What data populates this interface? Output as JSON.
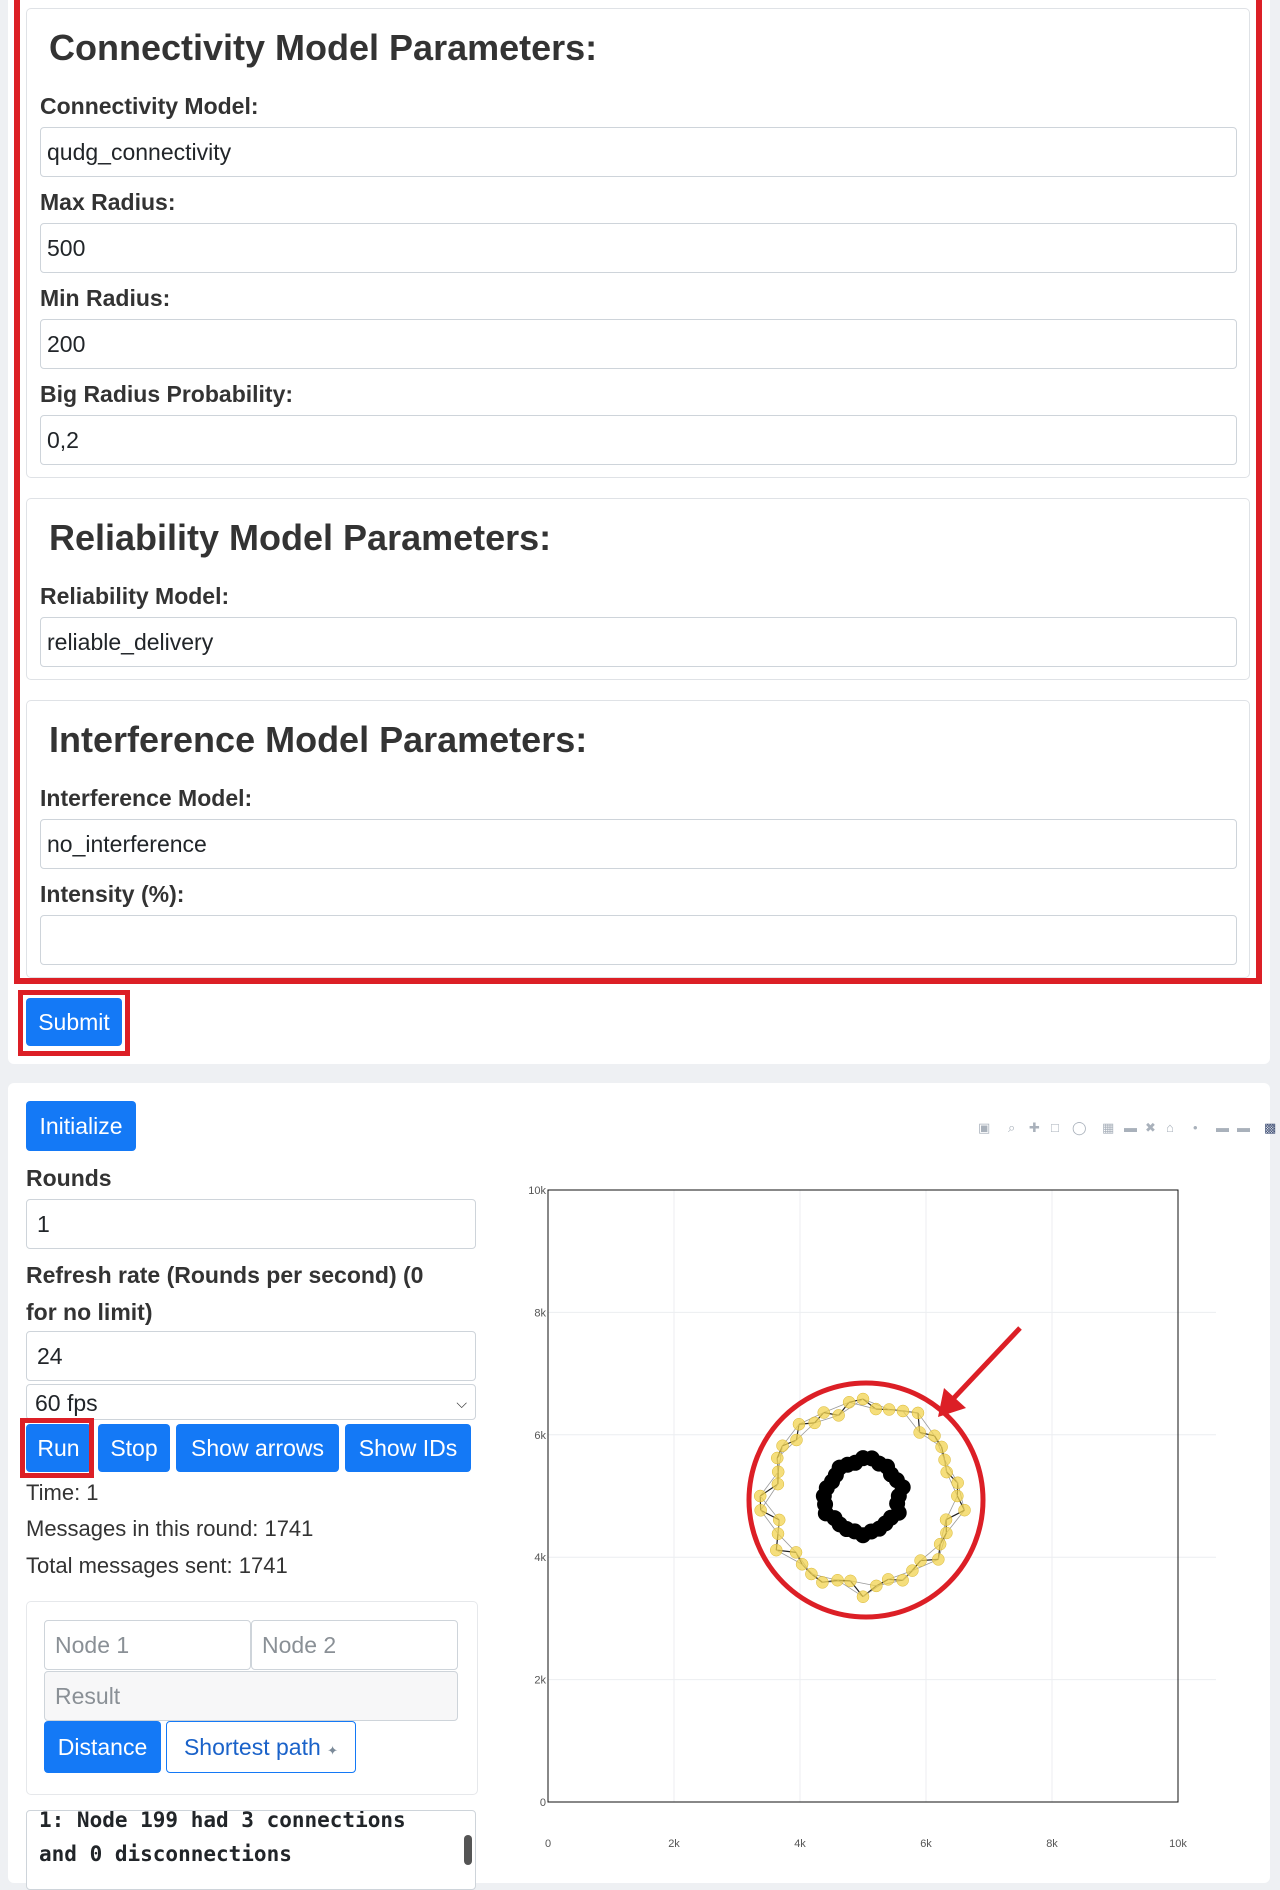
{
  "connectivity": {
    "title": "Connectivity Model Parameters:",
    "fields": [
      {
        "label": "Connectivity Model:",
        "value": "qudg_connectivity"
      },
      {
        "label": "Max Radius:",
        "value": "500"
      },
      {
        "label": "Min Radius:",
        "value": "200"
      },
      {
        "label": "Big Radius Probability:",
        "value": "0,2"
      }
    ]
  },
  "reliability": {
    "title": "Reliability Model Parameters:",
    "fields": [
      {
        "label": "Reliability Model:",
        "value": "reliable_delivery"
      }
    ]
  },
  "interference": {
    "title": "Interference Model Parameters:",
    "fields": [
      {
        "label": "Interference Model:",
        "value": "no_interference"
      },
      {
        "label": "Intensity (%):",
        "value": ""
      }
    ]
  },
  "submit_label": "Submit",
  "sim": {
    "initialize_label": "Initialize",
    "rounds_label": "Rounds",
    "rounds_value": "1",
    "refresh_label_line1": "Refresh rate (Rounds per second) (0",
    "refresh_label_line2": "for no limit)",
    "refresh_value": "24",
    "fps_selected": "60 fps",
    "run_label": "Run",
    "stop_label": "Stop",
    "show_arrows_label": "Show arrows",
    "show_ids_label": "Show IDs",
    "time_text": "Time: 1",
    "messages_round_text": "Messages in this round: 1741",
    "total_messages_text": "Total messages sent: 1741"
  },
  "query": {
    "node1_placeholder": "Node 1",
    "node2_placeholder": "Node 2",
    "result_placeholder": "Result",
    "distance_label": "Distance",
    "shortest_path_label": "Shortest path"
  },
  "log": {
    "line1": "1: Node 199 had 3 connections",
    "line2": "and 0 disconnections"
  },
  "colors": {
    "annotation_red": "#dc1f26",
    "primary_blue": "#1479f6",
    "node_yellow": "#f2d34f"
  },
  "chart_data": {
    "type": "scatter",
    "title": "",
    "xlabel": "",
    "ylabel": "",
    "xlim": [
      0,
      10000
    ],
    "ylim": [
      0,
      10000
    ],
    "x_ticks": [
      "0",
      "2k",
      "4k",
      "6k",
      "8k",
      "10k"
    ],
    "y_ticks": [
      "0",
      "2k",
      "4k",
      "6k",
      "8k",
      "10k"
    ],
    "grid": true,
    "series": [
      {
        "ring_center": [
          5000,
          5000
        ],
        "ring_radius": 1500,
        "point_count": 44,
        "color": "#f2d34f"
      },
      {
        "ring_center": [
          5000,
          5000
        ],
        "ring_radius": 600,
        "point_count": 28,
        "color": "#000000"
      }
    ]
  }
}
